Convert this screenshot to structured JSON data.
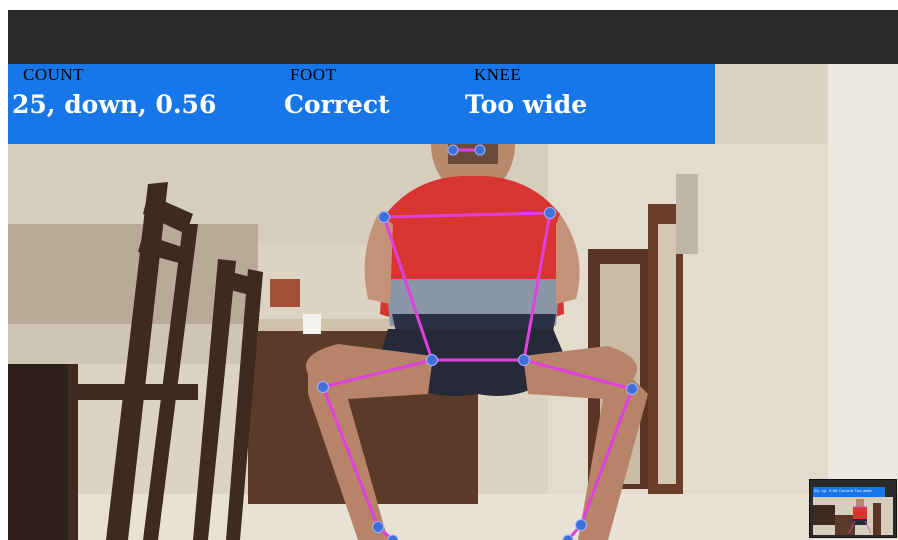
{
  "window": {
    "title": ""
  },
  "status_panel": {
    "count": {
      "label": "COUNT",
      "value": "25, down, 0.56"
    },
    "foot": {
      "label": "FOOT",
      "value": "Correct"
    },
    "knee": {
      "label": "KNEE",
      "value": "Too wide"
    }
  },
  "pip": {
    "overlay_text": "25, up, 0.56   Correct   Too wide"
  },
  "colors": {
    "panel": "#1877e8",
    "titlebar": "#2b2b2b",
    "skeleton_line": "#e040e0",
    "skeleton_joint": "#3f6fd8"
  }
}
